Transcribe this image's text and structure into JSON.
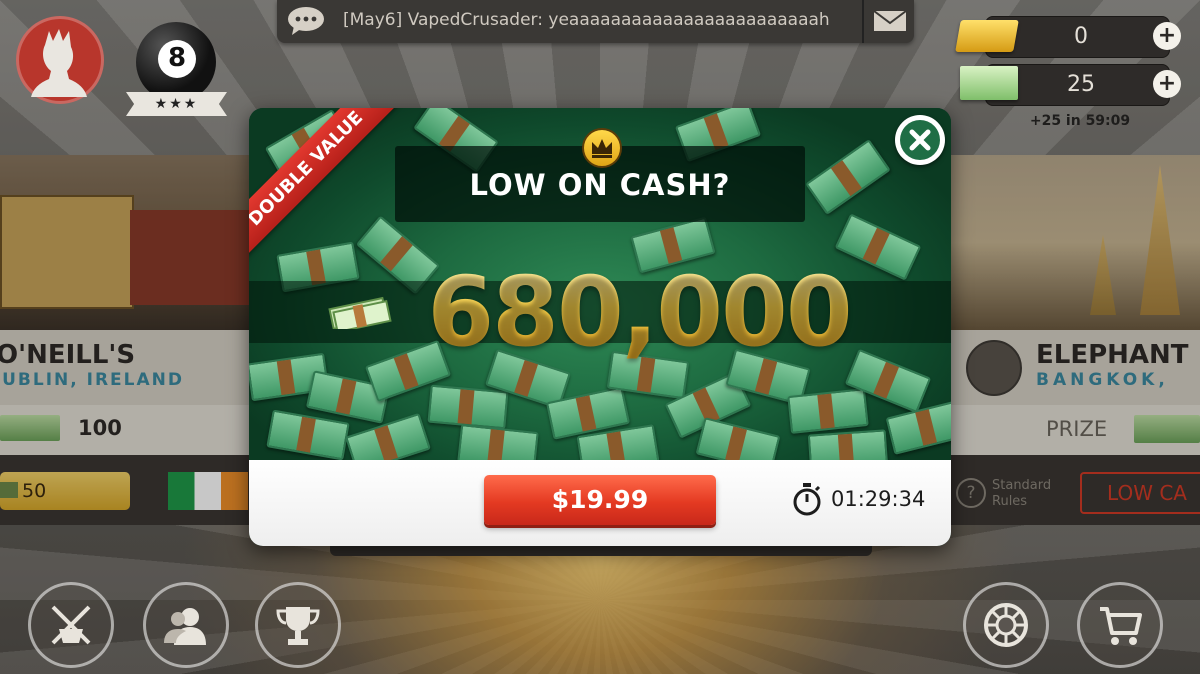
{
  "chat": {
    "message": "[May6] VapedCrusader: yeaaaaaaaaaaaaaaaaaaaaaaaah",
    "chat_icon": "speech-bubble-icon",
    "mail_icon": "envelope-icon"
  },
  "player": {
    "avatar_icon": "player-avatar-icon",
    "level_number": "8",
    "stars": "★★★"
  },
  "currency": {
    "gold": "0",
    "cash": "25",
    "refill_timer": "+25 in 59:09",
    "plus_label": "+"
  },
  "left_venue": {
    "name": "O'NEILL'S",
    "city": "DUBLIN, IRELAND",
    "prize_amount": "100",
    "entry_fee": "50"
  },
  "right_venue": {
    "name": "ELEPHANT",
    "city": "BANGKOK,",
    "prize_label": "PRIZE",
    "rules_label_1": "Standard",
    "rules_label_2": "Rules",
    "button_label": "LOW CA"
  },
  "popup": {
    "ribbon": "DOUBLE VALUE",
    "title": "LOW ON CASH?",
    "amount": "680,000",
    "price": "$19.99",
    "countdown": "01:29:34",
    "close_icon": "close-icon",
    "crown_icon": "crown-icon",
    "timer_icon": "stopwatch-icon"
  },
  "bottom_nav": {
    "left": [
      "crossed-cues-icon",
      "friends-icon",
      "trophy-icon"
    ],
    "right": [
      "spin-wheel-icon",
      "shopping-cart-icon"
    ]
  },
  "colors": {
    "accent_red": "#e43a22",
    "gold_text": "#f7c73e",
    "popup_green": "#1d6a40"
  }
}
